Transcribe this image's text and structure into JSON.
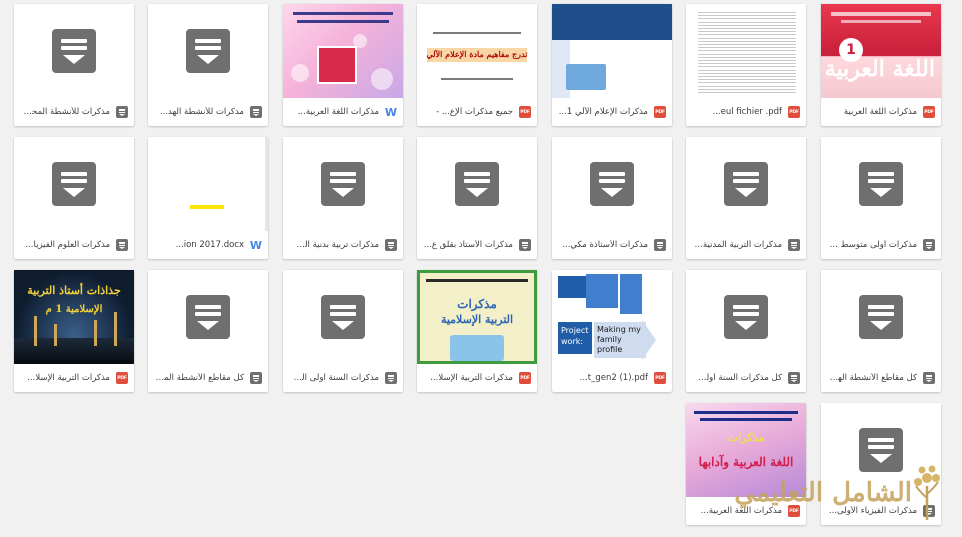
{
  "files": [
    {
      "id": "c1",
      "name": "مذكرات اللغة العربية",
      "type": "pdf",
      "thumb": "ar-book"
    },
    {
      "id": "c2",
      "name": "...eul fichier .pdf",
      "type": "pdf",
      "thumb": "doc-lines"
    },
    {
      "id": "c3",
      "name": "مذكرات الإعلام الآلي 1...",
      "type": "pdf",
      "thumb": "slide"
    },
    {
      "id": "c4",
      "name": "جميع مذكرات الإع... -",
      "type": "pdf",
      "thumb": "text-page"
    },
    {
      "id": "c5",
      "name": "مذكرات اللغة العربية...",
      "type": "doc",
      "thumb": "flowers"
    },
    {
      "id": "c6",
      "name": "مذكرات للأنشطة الهد...",
      "type": "archive",
      "thumb": "blank"
    },
    {
      "id": "c7",
      "name": "مذكرات للأنشطة المحد...",
      "type": "archive",
      "thumb": "blank"
    },
    {
      "id": "c8",
      "name": "مذكرات أولى متوسط ع...",
      "type": "archive",
      "thumb": "blank"
    },
    {
      "id": "c9",
      "name": "مذكرات التربية المدنية أ...",
      "type": "archive",
      "thumb": "blank"
    },
    {
      "id": "c10",
      "name": "مذكرات الأستاذة مكي...",
      "type": "archive",
      "thumb": "blank"
    },
    {
      "id": "c11",
      "name": "مذكرات الأستاذ بقلق ع...",
      "type": "archive",
      "thumb": "blank"
    },
    {
      "id": "c12",
      "name": "مذكرات تربية بدنية الس...",
      "type": "archive",
      "thumb": "blank"
    },
    {
      "id": "c13",
      "name": "...ion 2017.docx",
      "type": "doc",
      "thumb": "yellow-mark"
    },
    {
      "id": "c14",
      "name": "مذكرات العلوم الفيزيائ...",
      "type": "archive",
      "thumb": "blank"
    },
    {
      "id": "c15",
      "name": "كل مقاطع الأنشطة الهد...",
      "type": "archive",
      "thumb": "blank"
    },
    {
      "id": "c16",
      "name": "كل مذكرات السنة أولى...",
      "type": "archive",
      "thumb": "blank"
    },
    {
      "id": "c17",
      "name": "...t_gen2 (1).pdf",
      "type": "pdf",
      "thumb": "flow"
    },
    {
      "id": "c18",
      "name": "مذكرات التربية الإسلا...",
      "type": "pdf",
      "thumb": "islam-book"
    },
    {
      "id": "c19",
      "name": "مذكرات السنة اولى الم...",
      "type": "archive",
      "thumb": "blank"
    },
    {
      "id": "c20",
      "name": "كل مقاطع الأنشطة الما...",
      "type": "archive",
      "thumb": "blank"
    },
    {
      "id": "c21",
      "name": "مذكرات التربية الإسلا...",
      "type": "pdf",
      "thumb": "mosque"
    },
    {
      "id": "c22",
      "name": "مذكرات الفيزياء الأولى...",
      "type": "archive",
      "thumb": "blank"
    },
    {
      "id": "c23",
      "name": "مذكرات اللغة العربية...",
      "type": "pdf",
      "thumb": "arlit"
    }
  ],
  "icons": {
    "pdf_label": "PDF",
    "doc_label": "W"
  },
  "thumb_text": {
    "ar_book_number": "1",
    "ar_book_title": "اللغة العربية",
    "text_page_banner": "تدرج مفاهيم مادة الإعلام الآلي",
    "mosque_title": "جذاذات أستاذ التربية",
    "mosque_title2": "الإسلامية 1 م",
    "islam_title": "مذكرات",
    "islam_title2": "التربية الإسلامية",
    "flow_b4": "Project work:",
    "flow_b5": "Making my family profile",
    "arlit_title": "مذكرات",
    "arlit_title2": "اللغة العربية وآدابها"
  },
  "watermark": {
    "text": "الشامل التعليمي"
  },
  "colors": {
    "pdf": "#e04e3b",
    "doc": "#4a86e8",
    "archive": "#6f6f6f",
    "background": "#f1f1f1"
  }
}
